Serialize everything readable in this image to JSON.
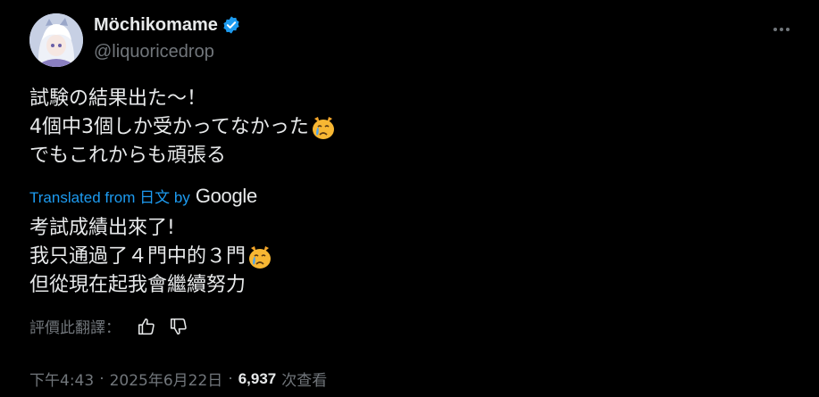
{
  "user": {
    "display_name": "Möchikomame",
    "handle": "@liquoricedrop",
    "verified": true
  },
  "icons": {
    "avatar": "anime-avatar",
    "verified": "verified-badge-icon",
    "more": "more-options-icon",
    "emoji": "crying-cat-face-emoji",
    "thumbs_up": "thumbs-up-icon",
    "thumbs_down": "thumbs-down-icon"
  },
  "colors": {
    "accent": "#1d9bf0",
    "text": "#e7e9ea",
    "muted": "#71767b",
    "background": "#000000"
  },
  "tweet": {
    "original_lines": [
      "試験の結果出た〜！",
      "4個中3個しか受かってなかった",
      "でもこれからも頑張る"
    ],
    "translated_label": "Translated from 日文 by",
    "translator": "Google",
    "translated_lines": [
      "考試成績出來了!",
      "我只通過了４門中的３門",
      "但從現在起我會繼續努力"
    ],
    "rate_label": "評價此翻譯：",
    "time": "下午4:43",
    "separator": "·",
    "date": "2025年6月22日",
    "views_count": "6,937",
    "views_label": "次查看"
  }
}
